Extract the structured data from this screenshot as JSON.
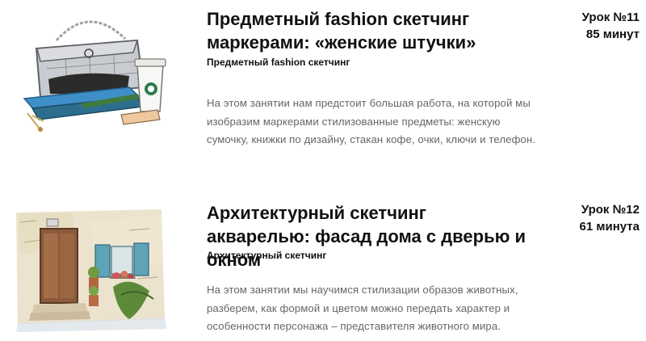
{
  "lessons": [
    {
      "title": "Предметный fashion скетчинг маркерами: «женские штучки»",
      "category": "Предметный fashion скетчинг",
      "description": "На этом занятии нам предстоит большая работа, на которой мы изобразим маркерами стилизованные предметы: женскую сумочку, книжки по дизайну, стакан кофе, очки, ключи и телефон.",
      "lesson_number": "Урок №11",
      "duration": "85 минут",
      "thumbnail": "handbag-books-coffee-sketch-image"
    },
    {
      "title": "Архитектурный скетчинг акварелью: фасад дома с дверью и окном",
      "category": "Архитектурный скетчинг",
      "description": "На этом занятии мы научимся стилизации образов животных, разберем, как формой и цветом можно передать характер и особенности персонажа – представителя животного мира.",
      "lesson_number": "Урок №12",
      "duration": "61 минута",
      "thumbnail": "house-facade-watercolor-image"
    }
  ]
}
